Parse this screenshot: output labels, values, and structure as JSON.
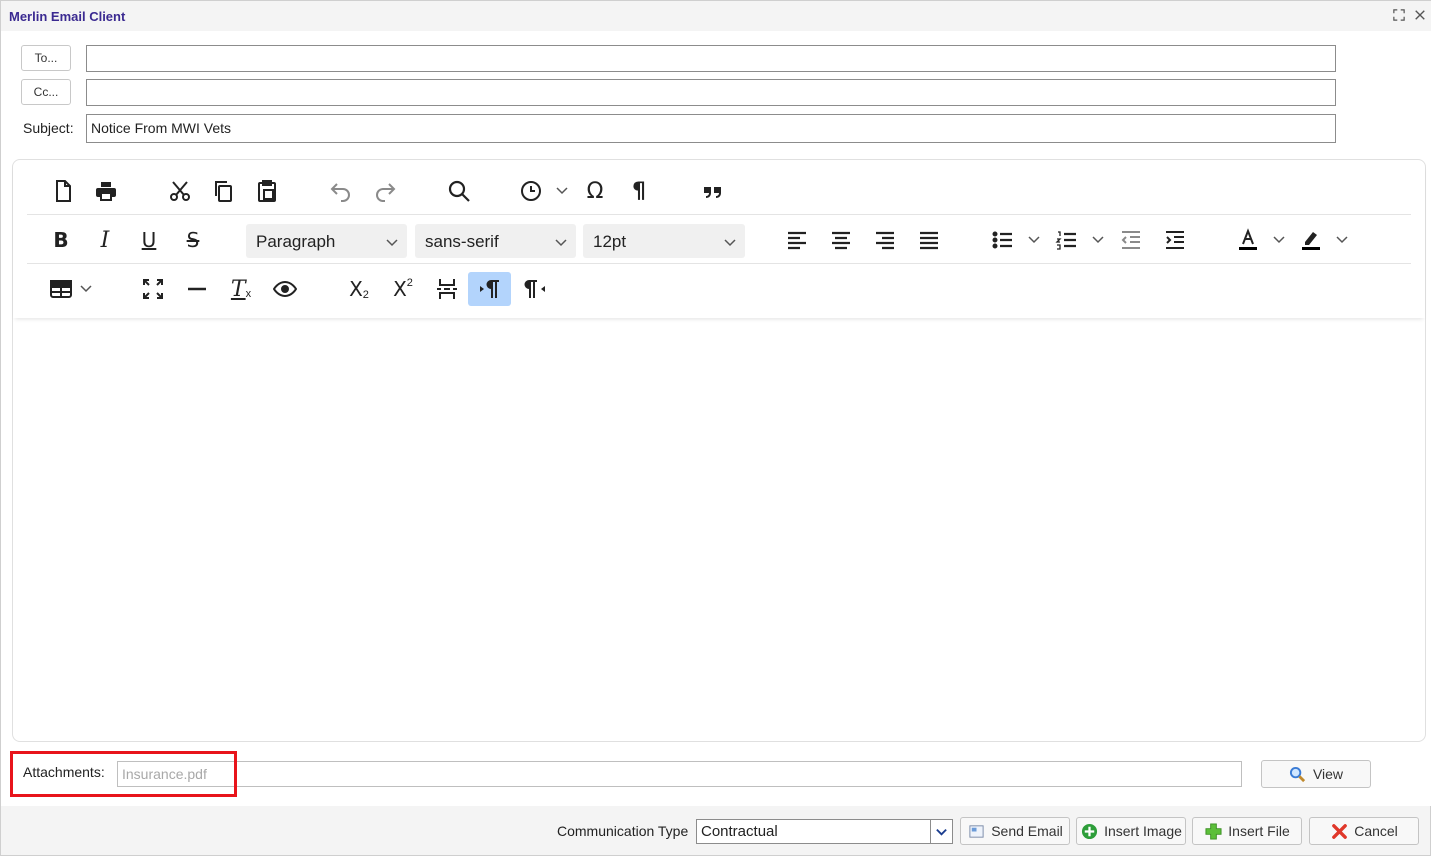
{
  "window": {
    "title": "Merlin Email Client",
    "controls": [
      "expand-icon",
      "close-icon"
    ]
  },
  "address": {
    "to_label": "To...",
    "to_value": "",
    "cc_label": "Cc...",
    "cc_value": "",
    "subject_label": "Subject:",
    "subject_value": "Notice From MWI Vets"
  },
  "toolbar": {
    "block_format": "Paragraph",
    "font_family": "sans-serif",
    "font_size": "12pt",
    "row1": [
      "new-document-icon",
      "print-icon",
      "cut-icon",
      "copy-icon",
      "paste-icon",
      "undo-icon",
      "redo-icon",
      "search-icon",
      "clock-icon",
      "omega-icon",
      "pilcrow-icon",
      "blockquote-icon"
    ],
    "row2": [
      "bold-icon",
      "italic-icon",
      "underline-icon",
      "strikethrough-icon",
      "align-left-icon",
      "align-center-icon",
      "align-right-icon",
      "justify-icon",
      "bullet-list-icon",
      "numbered-list-icon",
      "outdent-icon",
      "indent-icon",
      "text-color-icon",
      "highlight-icon"
    ],
    "row3": [
      "table-icon",
      "fullscreen-icon",
      "horizontal-rule-icon",
      "clear-format-icon",
      "preview-icon",
      "subscript-icon",
      "superscript-icon",
      "page-break-icon",
      "ltr-icon",
      "rtl-icon"
    ],
    "active": "ltr-icon"
  },
  "attachments": {
    "label": "Attachments:",
    "value": "Insurance.pdf",
    "view_label": "View"
  },
  "footer": {
    "communication_type_label": "Communication Type",
    "communication_type_value": "Contractual",
    "send_label": "Send Email",
    "insert_image_label": "Insert Image",
    "insert_file_label": "Insert File",
    "cancel_label": "Cancel"
  },
  "colors": {
    "title": "#3b2a91",
    "highlight_box": "#e8141b",
    "active_button": "#b3d4fc"
  }
}
